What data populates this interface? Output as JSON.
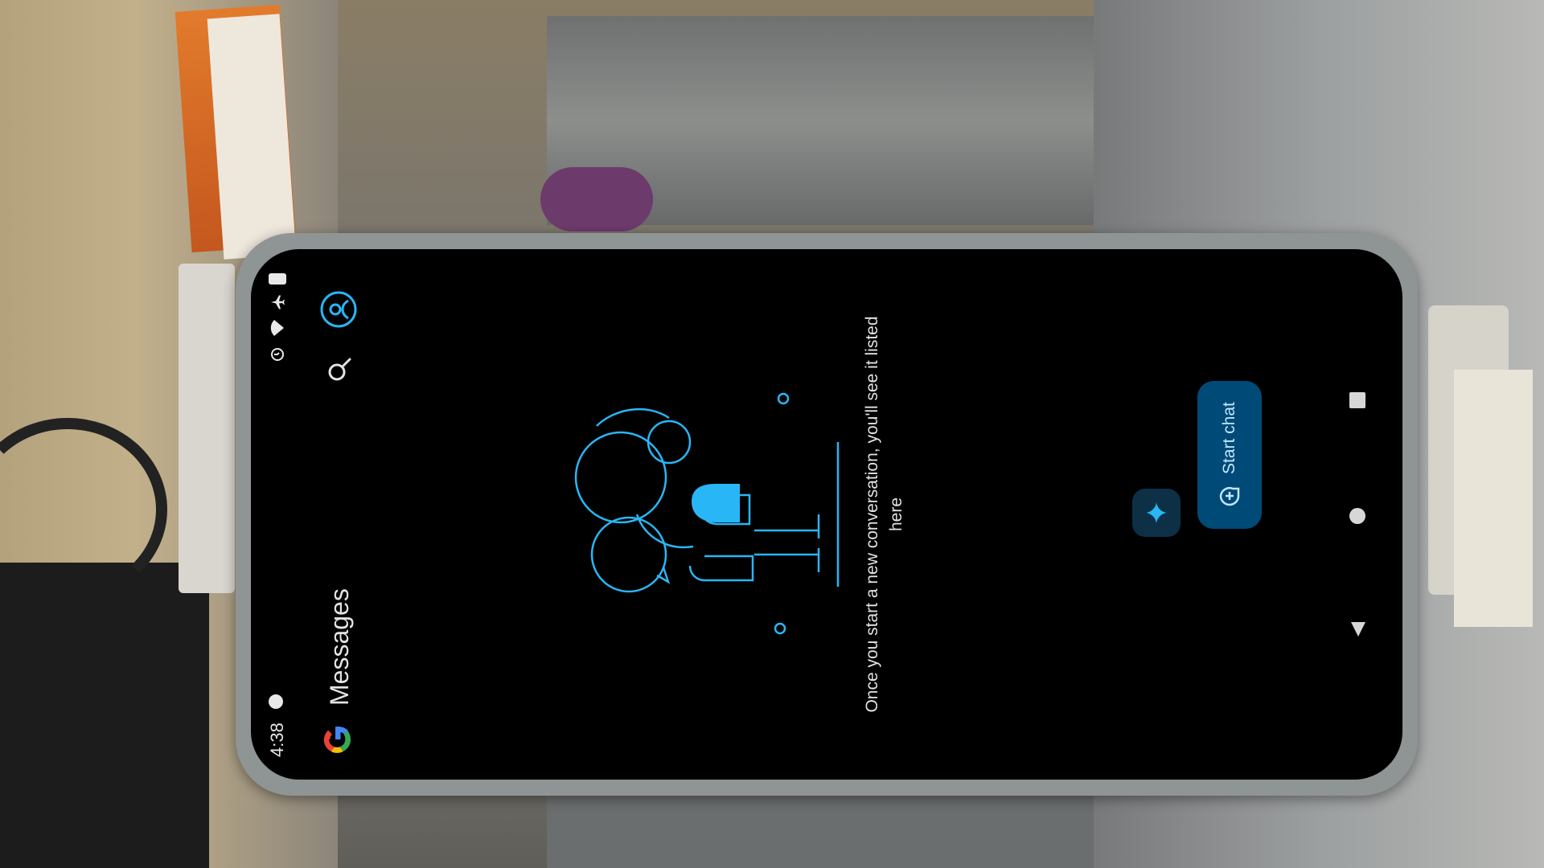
{
  "status_bar": {
    "time": "4:38",
    "icons": [
      "notification-dot-icon",
      "alarm-icon",
      "wifi-icon",
      "airplane-icon",
      "battery-icon"
    ]
  },
  "app_bar": {
    "logo": "google-g-logo",
    "title": "Messages",
    "search_icon": "search-icon",
    "avatar_icon": "account-avatar-icon"
  },
  "empty_state": {
    "illustration": "people-with-speech-bubbles-illustration",
    "message": "Once you start a new conversation, you'll see it listed here"
  },
  "actions": {
    "start_chat_label": "Start chat",
    "start_chat_icon": "chat-bubble-add-icon",
    "gemini_icon": "sparkle-icon"
  },
  "nav_bar": {
    "back": "back-triangle-icon",
    "home": "home-circle-icon",
    "recents": "recents-square-icon"
  },
  "colors": {
    "background": "#000000",
    "accent": "#29b6f6",
    "fab_bg": "#004a77",
    "fab_text": "#c2e7ff"
  }
}
